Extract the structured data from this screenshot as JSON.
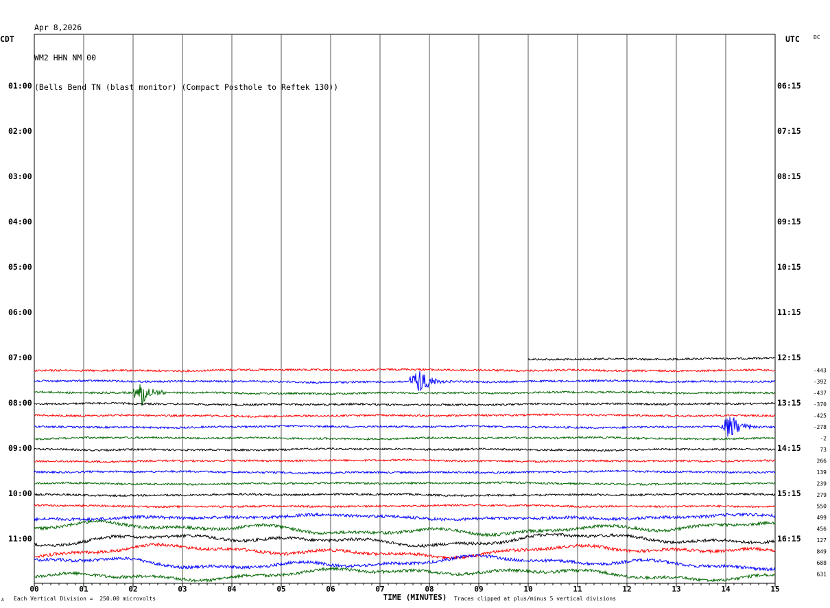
{
  "header": {
    "line1": "Apr 8,2026",
    "line2": "WM2 HHN NM 00",
    "line3": "(Bells Bend TN (blast monitor) (Compact Posthole to Reftek 130))"
  },
  "labels": {
    "left_timezone": "CDT",
    "right_timezone": "UTC",
    "dc": "DC",
    "xlabel": "TIME (MINUTES)",
    "scale_note": "Each Vertical Division =  250.00 microvolts",
    "clip_note": "Traces clipped at plus/minus 5 vertical divisions",
    "corner_mark": "A"
  },
  "colors": {
    "red": "#ff0000",
    "blue": "#0000ff",
    "green": "#006600",
    "black": "#000000",
    "grid": "#555555"
  },
  "chart_data": {
    "type": "line",
    "xlabel": "TIME (MINUTES)",
    "xlim": [
      0,
      15
    ],
    "x_ticks": [
      "00",
      "01",
      "02",
      "03",
      "04",
      "05",
      "06",
      "07",
      "08",
      "09",
      "10",
      "11",
      "12",
      "13",
      "14",
      "15"
    ],
    "grid": true,
    "left_hour_labels": [
      "01:00",
      "02:00",
      "03:00",
      "04:00",
      "05:00",
      "06:00",
      "07:00",
      "08:00",
      "09:00",
      "10:00",
      "11:00"
    ],
    "right_hour_labels": [
      "06:15",
      "07:15",
      "08:15",
      "09:15",
      "10:15",
      "11:15",
      "12:15",
      "13:15",
      "14:15",
      "15:15",
      "16:15"
    ],
    "trace_colors": [
      "black",
      "red",
      "blue",
      "green"
    ],
    "traces": [
      {
        "color": "black",
        "start_minute": 10,
        "amplitude": "low",
        "mean_label": ""
      },
      {
        "color": "red",
        "amplitude": "low",
        "mean_label": "-443"
      },
      {
        "color": "blue",
        "amplitude": "low",
        "mean_label": "-392",
        "burst_minute": 7.8
      },
      {
        "color": "green",
        "amplitude": "low",
        "mean_label": "-437",
        "burst_minute": 2.2
      },
      {
        "color": "black",
        "amplitude": "low",
        "mean_label": "-370"
      },
      {
        "color": "red",
        "amplitude": "low",
        "mean_label": "-425"
      },
      {
        "color": "blue",
        "amplitude": "low",
        "mean_label": "-278",
        "burst_minute": 14.1
      },
      {
        "color": "green",
        "amplitude": "low",
        "mean_label": "-2"
      },
      {
        "color": "black",
        "amplitude": "low",
        "mean_label": "73"
      },
      {
        "color": "red",
        "amplitude": "low",
        "mean_label": "266"
      },
      {
        "color": "blue",
        "amplitude": "low",
        "mean_label": "139"
      },
      {
        "color": "green",
        "amplitude": "low",
        "mean_label": "239"
      },
      {
        "color": "black",
        "amplitude": "low",
        "mean_label": "279"
      },
      {
        "color": "red",
        "amplitude": "low",
        "mean_label": "550"
      },
      {
        "color": "blue",
        "amplitude": "medium",
        "mean_label": "499"
      },
      {
        "color": "green",
        "amplitude": "high",
        "mean_label": "456"
      },
      {
        "color": "black",
        "amplitude": "high",
        "mean_label": "127"
      },
      {
        "color": "red",
        "amplitude": "high",
        "mean_label": "849"
      },
      {
        "color": "blue",
        "amplitude": "high",
        "mean_label": "688"
      },
      {
        "color": "green",
        "amplitude": "high",
        "mean_label": "631"
      }
    ]
  }
}
